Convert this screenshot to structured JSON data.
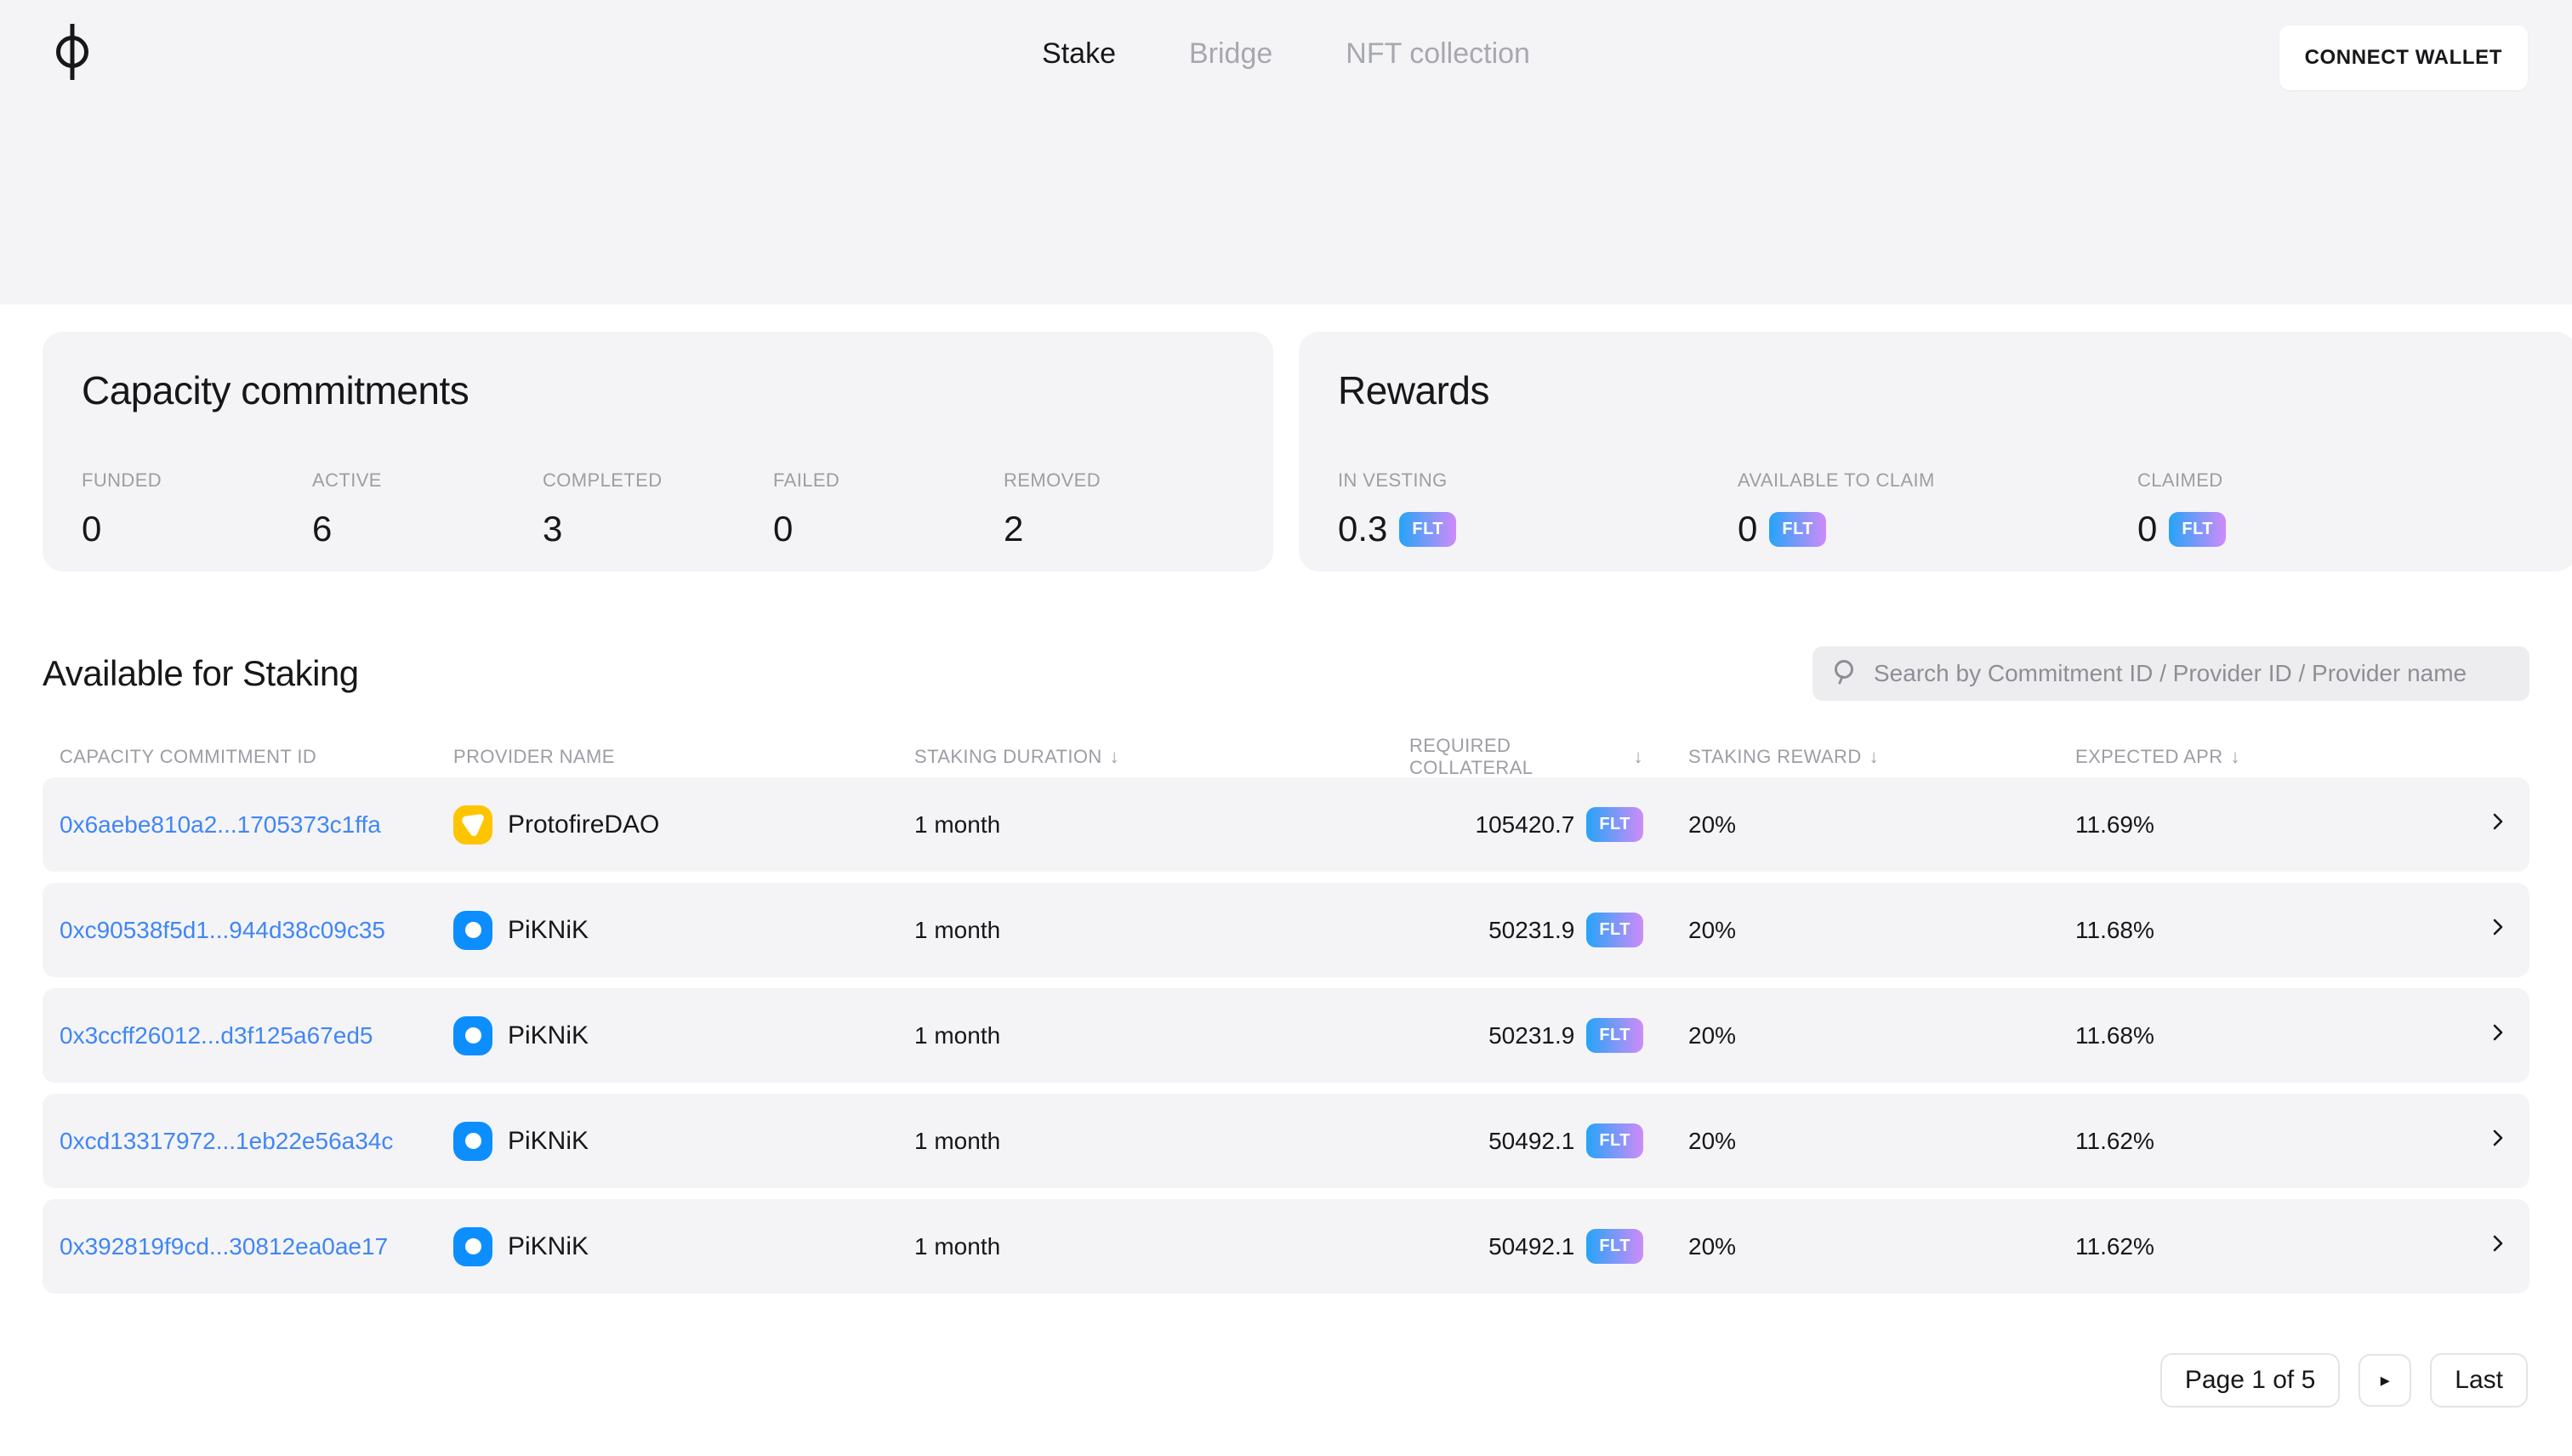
{
  "brand": {
    "logo_icon": "phi-logo-icon"
  },
  "nav": {
    "items": [
      {
        "label": "Stake",
        "active": true
      },
      {
        "label": "Bridge",
        "active": false
      },
      {
        "label": "NFT collection",
        "active": false
      }
    ],
    "connect_wallet_label": "CONNECT WALLET"
  },
  "capacity_card": {
    "title": "Capacity commitments",
    "stats": [
      {
        "label": "FUNDED",
        "value": "0"
      },
      {
        "label": "ACTIVE",
        "value": "6"
      },
      {
        "label": "COMPLETED",
        "value": "3"
      },
      {
        "label": "FAILED",
        "value": "0"
      },
      {
        "label": "REMOVED",
        "value": "2"
      }
    ]
  },
  "rewards_card": {
    "title": "Rewards",
    "token": "FLT",
    "stats": [
      {
        "label": "IN VESTING",
        "value": "0.3"
      },
      {
        "label": "AVAILABLE TO CLAIM",
        "value": "0"
      },
      {
        "label": "CLAIMED",
        "value": "0"
      }
    ]
  },
  "staking": {
    "title": "Available for Staking",
    "search_placeholder": "Search by Commitment ID / Provider ID / Provider name",
    "columns": [
      {
        "label": "CAPACITY COMMITMENT ID",
        "sort": ""
      },
      {
        "label": "PROVIDER NAME",
        "sort": ""
      },
      {
        "label": "STAKING DURATION",
        "sort": "↓"
      },
      {
        "label": "REQUIRED COLLATERAL",
        "sort": "↓"
      },
      {
        "label": "STAKING REWARD",
        "sort": "↓"
      },
      {
        "label": "EXPECTED APR",
        "sort": "↓"
      }
    ],
    "rows": [
      {
        "id": "0x6aebe810a2...1705373c1ffa",
        "provider": "ProtofireDAO",
        "provider_icon": "protofire",
        "duration": "1 month",
        "collateral": "105420.7",
        "token": "FLT",
        "reward": "20%",
        "apr": "11.69%"
      },
      {
        "id": "0xc90538f5d1...944d38c09c35",
        "provider": "PiKNiK",
        "provider_icon": "piknik",
        "duration": "1 month",
        "collateral": "50231.9",
        "token": "FLT",
        "reward": "20%",
        "apr": "11.68%"
      },
      {
        "id": "0x3ccff26012...d3f125a67ed5",
        "provider": "PiKNiK",
        "provider_icon": "piknik",
        "duration": "1 month",
        "collateral": "50231.9",
        "token": "FLT",
        "reward": "20%",
        "apr": "11.68%"
      },
      {
        "id": "0xcd13317972...1eb22e56a34c",
        "provider": "PiKNiK",
        "provider_icon": "piknik",
        "duration": "1 month",
        "collateral": "50492.1",
        "token": "FLT",
        "reward": "20%",
        "apr": "11.62%"
      },
      {
        "id": "0x392819f9cd...30812ea0ae17",
        "provider": "PiKNiK",
        "provider_icon": "piknik",
        "duration": "1 month",
        "collateral": "50492.1",
        "token": "FLT",
        "reward": "20%",
        "apr": "11.62%"
      }
    ]
  },
  "pagination": {
    "page_label": "Page 1 of 5",
    "next_label": "▸",
    "last_label": "Last"
  },
  "colors": {
    "header_bg": "#f4f4f6",
    "card_bg": "#f4f4f6",
    "link_blue": "#4186f5",
    "flt_gradient_start": "#25a4f8",
    "flt_gradient_end": "#cf8bf8",
    "protofire_yellow": "#ffc400",
    "piknik_blue": "#0d8eff"
  }
}
